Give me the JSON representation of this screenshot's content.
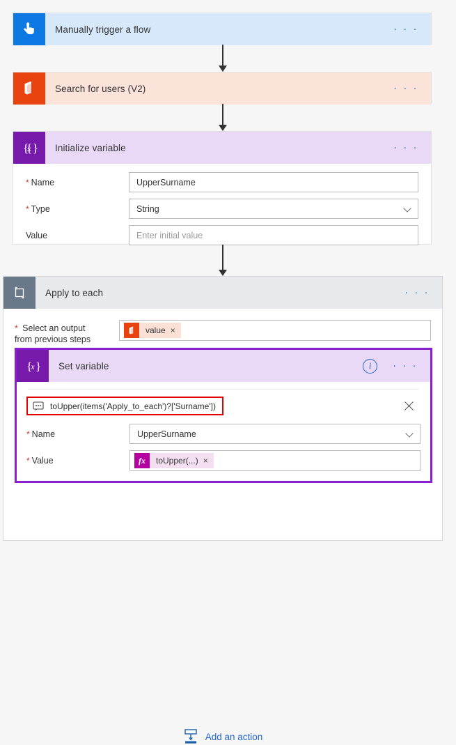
{
  "flow": {
    "steps": [
      {
        "id": "trigger",
        "title": "Manually trigger a flow",
        "icon": "touch-tap-icon",
        "header_color": "#d6e8fa",
        "icon_color": "#0d77e2",
        "menu": "· · ·"
      },
      {
        "id": "office",
        "title": "Search for users (V2)",
        "icon": "office-365-icon",
        "header_color": "#fbe3da",
        "icon_color": "#e8430f",
        "menu": "· · ·"
      },
      {
        "id": "initvar",
        "title": "Initialize variable",
        "icon": "variable-braces-icon",
        "header_color": "#e9d9f7",
        "icon_color": "#7719aa",
        "menu": "· · ·"
      }
    ]
  },
  "initialize_variable": {
    "fields": [
      {
        "label": "Name",
        "required": true,
        "value": "UpperSurname",
        "is_placeholder": false,
        "control": "text"
      },
      {
        "label": "Type",
        "required": true,
        "value": "String",
        "is_placeholder": false,
        "control": "dropdown"
      },
      {
        "label": "Value",
        "required": false,
        "value": "Enter initial value",
        "is_placeholder": true,
        "control": "text"
      }
    ]
  },
  "apply_to_each": {
    "title": "Apply to each",
    "icon": "loop-icon",
    "header_color": "#e6eaed",
    "icon_color": "#69798a",
    "menu": "· · ·",
    "output_label_line1": "Select an output",
    "output_label_line2": "from previous steps",
    "output_required": true,
    "output_token": {
      "icon": "office-365-icon",
      "text": "value",
      "remove": "×"
    }
  },
  "set_variable": {
    "title": "Set variable",
    "icon": "variable-braces-icon",
    "header_color": "#e9d9f7",
    "icon_color": "#7719aa",
    "selected_border_color": "#8a1fd0",
    "info_icon": "info-circle-icon",
    "menu": "· · ·",
    "expression": {
      "icon": "comment-bubble-icon",
      "text": "toUpper(items('Apply_to_each')?['Surname'])",
      "highlight_color": "#e50000",
      "close": "close-icon"
    },
    "fields": [
      {
        "label": "Name",
        "required": true,
        "value": "UpperSurname",
        "control": "dropdown"
      }
    ],
    "value_field": {
      "label": "Value",
      "required": true,
      "token": {
        "icon": "fx-icon",
        "icon_text": "fx",
        "text": "toUpper(...)",
        "remove": "×"
      }
    }
  },
  "add_action": {
    "label": "Add an action",
    "icon": "add-action-icon",
    "color": "#2266cc"
  }
}
